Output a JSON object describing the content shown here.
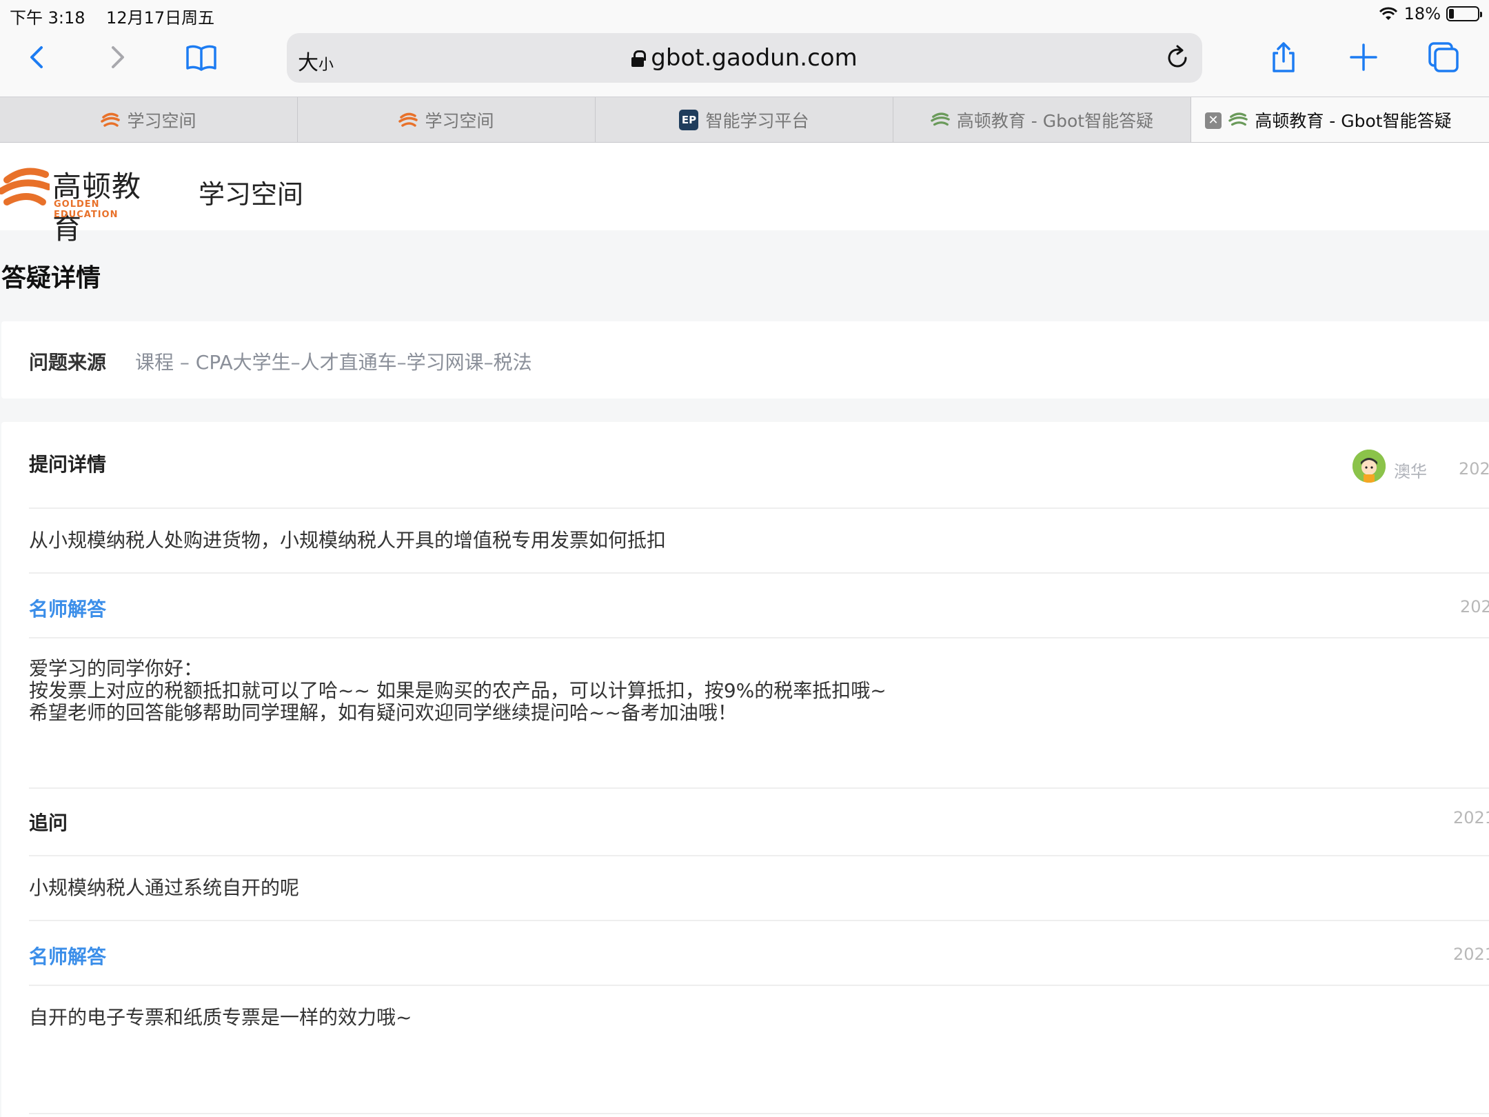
{
  "status_bar": {
    "time": "下午 3:18",
    "date": "12月17日周五",
    "battery": "18%",
    "battery_level": 0.18
  },
  "browser": {
    "text_size_label": "大",
    "text_size_small": "小",
    "url": "gbot.gaodun.com",
    "tabs": [
      {
        "label": "学习空间",
        "favicon": "gaodun-logo-icon",
        "active": false
      },
      {
        "label": "学习空间",
        "favicon": "gaodun-logo-icon",
        "active": false
      },
      {
        "label": "智能学习平台",
        "favicon": "ep-icon",
        "favicon_text": "EP",
        "active": false
      },
      {
        "label": "高顿教育 - Gbot智能答疑",
        "favicon": "gbot-icon",
        "active": false
      },
      {
        "label": "高顿教育 - Gbot智能答疑",
        "favicon": "gbot-icon",
        "active": true
      }
    ]
  },
  "header": {
    "logo_cn": "高顿教育",
    "logo_en": "GOLDEN   EDUCATION",
    "site_title": "学习空间"
  },
  "page": {
    "title": "答疑详情",
    "source_label": "问题来源",
    "source_value": "课程 – CPA大学生–人才直通车–学习网课–税法"
  },
  "detail": {
    "question_title": "提问详情",
    "user_name": "澳华",
    "question_date": "202",
    "question_text": "从小规模纳税人处购进货物，小规模纳税人开具的增值税专用发票如何抵扣",
    "answer1_title": "名师解答",
    "answer1_date": "202",
    "answer1_text": "爱学习的同学你好：\n按发票上对应的税额抵扣就可以了哈~~ 如果是购买的农产品，可以计算抵扣，按9%的税率抵扣哦~\n希望老师的回答能够帮助同学理解，如有疑问欢迎同学继续提问哈~~备考加油哦！",
    "followup_title": "追问",
    "followup_date": "2021",
    "followup_text": "小规模纳税人通过系统自开的呢",
    "answer2_title": "名师解答",
    "answer2_date": "2021",
    "answer2_text": "自开的电子专票和纸质专票是一样的效力哦~"
  },
  "colors": {
    "accent_blue": "#3b8ee9",
    "brand_orange": "#e8712a",
    "icon_blue": "#1d7cf2"
  }
}
